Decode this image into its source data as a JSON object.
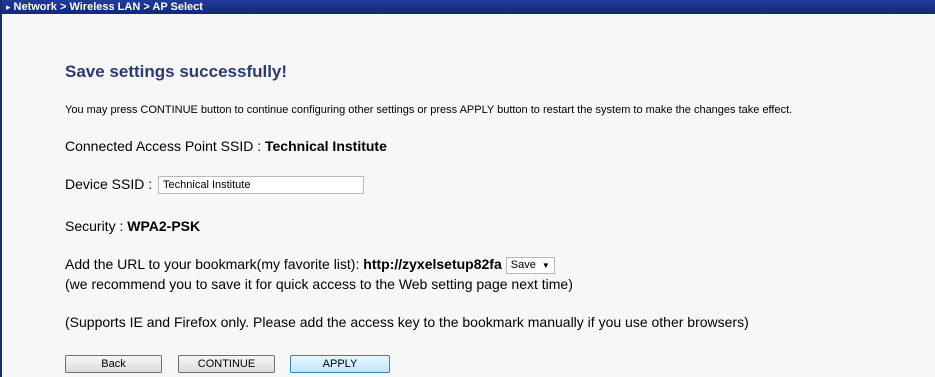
{
  "breadcrumb": "Network > Wireless LAN > AP Select",
  "heading": "Save settings successfully!",
  "note": "You may press CONTINUE button to continue configuring other settings or press APPLY button to restart the system to make the changes take effect.",
  "connected_ap": {
    "label": "Connected Access Point SSID : ",
    "value": "Technical Institute"
  },
  "device_ssid": {
    "label": "Device SSID : ",
    "value": "Technical Institute"
  },
  "security": {
    "label": "Security : ",
    "value": "WPA2-PSK"
  },
  "bookmark": {
    "label": "Add the URL to your bookmark(my favorite list): ",
    "url": "http://zyxelsetup82fa",
    "select_value": "Save",
    "hint": "(we recommend you to save it for quick access to the Web setting page next time)"
  },
  "support_note": "(Supports IE and Firefox only. Please add the access key to the bookmark manually if you use other browsers)",
  "buttons": {
    "back": "Back",
    "continue": "CONTINUE",
    "apply": "APPLY"
  }
}
